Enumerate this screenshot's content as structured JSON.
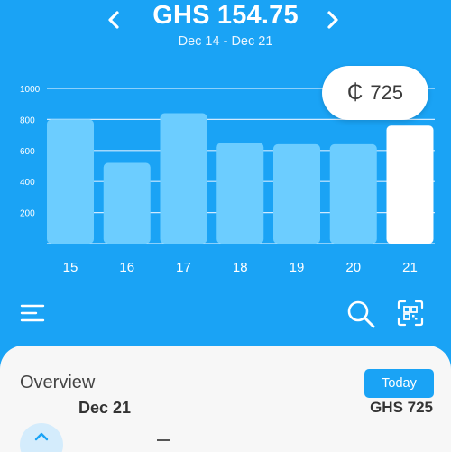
{
  "header": {
    "total": "GHS 154.75",
    "range": "Dec 14 - Dec 21"
  },
  "tooltip": {
    "symbol": "₵",
    "value": "725"
  },
  "chart_data": {
    "type": "bar",
    "categories": [
      "15",
      "16",
      "17",
      "18",
      "19",
      "20",
      "21"
    ],
    "values": [
      800,
      520,
      840,
      650,
      640,
      640,
      760
    ],
    "highlight_index": 6,
    "yticks": [
      200,
      400,
      600,
      800,
      1000
    ],
    "ylim": [
      0,
      1000
    ],
    "grid": true,
    "colors": {
      "bar": "#6ccdff",
      "highlight": "#ffffff",
      "grid": "#cfeaff"
    }
  },
  "overview": {
    "title": "Overview",
    "today_label": "Today"
  },
  "transaction": {
    "date": "Dec 21",
    "amount": "GHS 725"
  },
  "icons": {
    "prev": "chevron-left-icon",
    "next": "chevron-right-icon",
    "menu": "menu-icon",
    "search": "search-icon",
    "scan": "qr-scan-icon",
    "expand": "chevron-up-icon"
  }
}
